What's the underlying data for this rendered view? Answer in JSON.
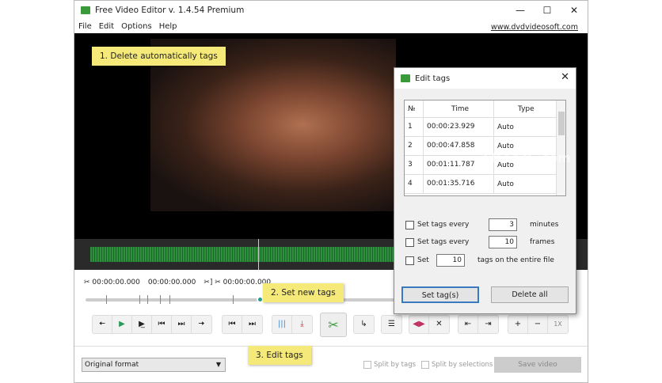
{
  "window": {
    "title": "Free Video Editor v. 1.4.54 Premium",
    "minimize": "—",
    "maximize": "☐",
    "close": "✕"
  },
  "menu": [
    "File",
    "Edit",
    "Options",
    "Help"
  ],
  "website": "www.dvdvideosoft.com",
  "timeline": {
    "start": "00:00:00.000",
    "end": "00:00:00.000",
    "duration": "00:00:00.000",
    "position_fraction": 0.55
  },
  "tooltips": {
    "t1": "1. Delete automatically tags",
    "t2": "2. Set new tags",
    "t3": "3. Edit tags"
  },
  "controls": {
    "group1": [
      "🠄",
      "▶",
      "▶̲",
      "⏮",
      "⏭",
      "🠆"
    ],
    "group2": [
      "⏮",
      "⏭"
    ],
    "group3": [
      "|||",
      "⤓"
    ],
    "cut": "✂",
    "rotate": "↳",
    "adjust": "☰",
    "group5": [
      "◀▶",
      "✕"
    ],
    "group6": [
      "⇤",
      "⇥"
    ],
    "group7": [
      "+",
      "−",
      "1X"
    ]
  },
  "bottom": {
    "format": "Original format",
    "split_tags": "Split by tags",
    "split_sel": "Split by selections",
    "save": "Save video"
  },
  "dialog": {
    "title": "Edit tags",
    "close": "✕",
    "headers": [
      "№",
      "Time",
      "Type"
    ],
    "rows": [
      [
        "1",
        "00:00:23.929",
        "Auto"
      ],
      [
        "2",
        "00:00:47.858",
        "Auto"
      ],
      [
        "3",
        "00:01:11.787",
        "Auto"
      ],
      [
        "4",
        "00:01:35.716",
        "Auto"
      ]
    ],
    "opt1": {
      "label": "Set tags every",
      "value": "3",
      "unit": "minutes"
    },
    "opt2": {
      "label": "Set tags every",
      "value": "10",
      "unit": "frames"
    },
    "opt3": {
      "label": "Set",
      "value": "10",
      "unit": "tags on the entire file"
    },
    "set_btn": "Set tag(s)",
    "delete_btn": "Delete all"
  },
  "watermark": "FILECR .com"
}
